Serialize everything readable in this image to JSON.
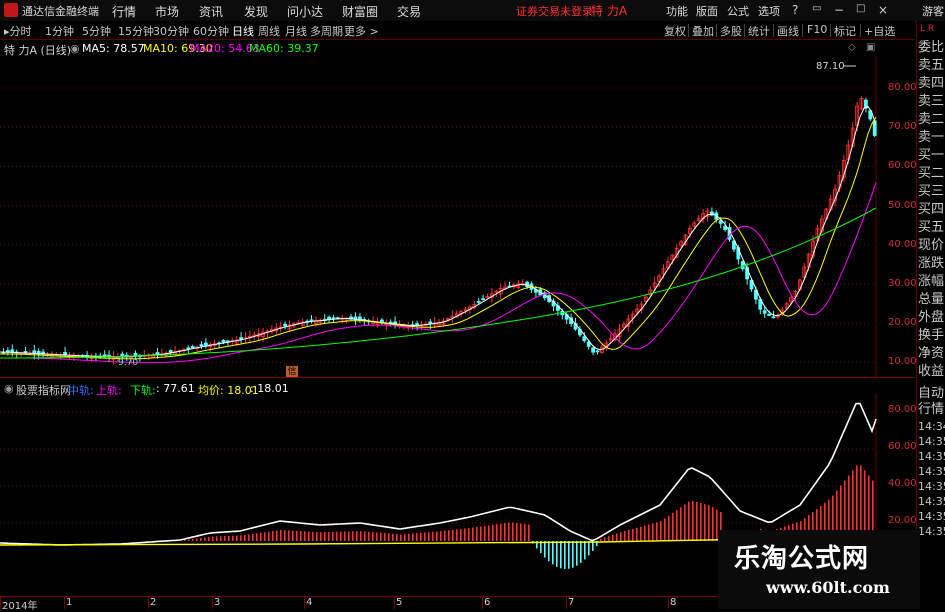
{
  "topbar": {
    "app_title": "通达信金融终端",
    "menus": [
      "行情",
      "市场",
      "资讯",
      "发现",
      "问小达",
      "财富圈",
      "交易"
    ],
    "login_warning": "证券交易未登录",
    "stock_name": "特 力A",
    "right_menus": [
      "功能",
      "版面",
      "公式",
      "选项"
    ],
    "guest": "游客"
  },
  "periodbar": {
    "periods": [
      "分时",
      "1分钟",
      "5分钟",
      "15分钟",
      "30分钟",
      "60分钟",
      "日线",
      "周线",
      "月线",
      "多周期",
      "更多 >"
    ],
    "active_index": 6,
    "tools": [
      "复权",
      "叠加",
      "多股",
      "统计",
      "画线",
      "F10",
      "标记",
      "+自选"
    ],
    "corner_label": "L R"
  },
  "main_chart": {
    "stock_label": "特 力A (日线)",
    "ma": [
      {
        "label": "MA5: 78.57",
        "color": "#ffffff"
      },
      {
        "label": "MA10: 69.30",
        "color": "#ffff00"
      },
      {
        "label": "MA20: 54.63",
        "color": "#ff00ff"
      },
      {
        "label": "MA60: 39.37",
        "color": "#00ff00"
      }
    ],
    "y_labels": [
      "80.00",
      "70.00",
      "60.00",
      "50.00",
      "40.00",
      "30.00",
      "20.00",
      "10.00"
    ],
    "high_label": "87.10",
    "low_label": "9.70",
    "marker_label": "信"
  },
  "sub_chart": {
    "name": "股票指标网",
    "items": [
      {
        "label": "中轨:",
        "color": "#3a6cff"
      },
      {
        "label": "上轨:",
        "color": "#ff00ff"
      },
      {
        "label": "下轨:",
        "color": "#00ff00"
      },
      {
        "label": ": 77.61",
        "color": "#ffffff"
      },
      {
        "label": "均价: 18.01",
        "color": "#ffff00"
      },
      {
        "label": ": 18.01",
        "color": "#ffffff"
      }
    ],
    "y_labels": [
      "80.00",
      "60.00",
      "40.00",
      "20.00"
    ],
    "time_labels": [
      "14:34",
      "14:35",
      "14:35",
      "14:35",
      "14:35",
      "14:35",
      "14:35",
      "14:35"
    ]
  },
  "sidebar": {
    "items": [
      "委比",
      "卖五",
      "卖四",
      "卖三",
      "卖二",
      "卖一",
      "买一",
      "买二",
      "买三",
      "买四",
      "买五",
      "现价",
      "涨跌",
      "涨幅",
      "总量",
      "外盘",
      "换手",
      "净资",
      "收益"
    ],
    "lower_items": [
      "自动",
      "行情"
    ]
  },
  "dates": {
    "labels": [
      "2014年",
      "1",
      "2",
      "3",
      "4",
      "5",
      "6",
      "7",
      "8"
    ]
  },
  "watermark": {
    "line1": "乐淘公式网",
    "line2": "www.60lt.com"
  },
  "colors": {
    "up": "#ff3030",
    "down": "#54ffff",
    "grid": "#6a0000",
    "ma5": "#ffffff",
    "ma10": "#ffff00",
    "ma20": "#ff00ff",
    "ma60": "#00ff00"
  },
  "chart_data": {
    "type": "line",
    "x_range": [
      "2014-01",
      "2014-09"
    ],
    "ylim": [
      10,
      80
    ],
    "series": [
      {
        "name": "MA5",
        "last": 78.57
      },
      {
        "name": "MA10",
        "last": 69.3
      },
      {
        "name": "MA20",
        "last": 54.63
      },
      {
        "name": "MA60",
        "last": 39.37
      }
    ],
    "max_price": 87.1,
    "min_price": 9.7
  }
}
